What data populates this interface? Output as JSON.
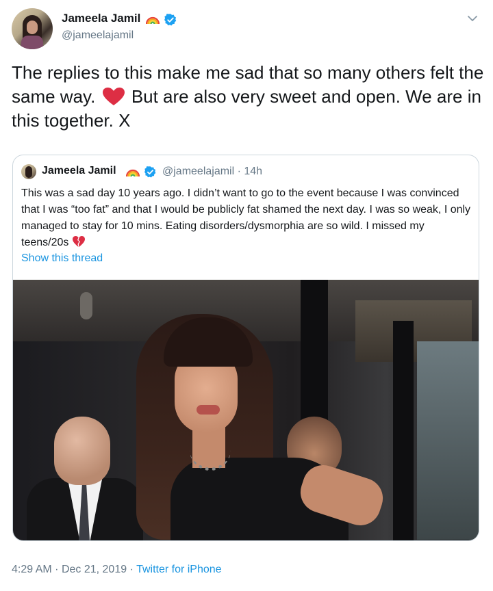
{
  "tweet": {
    "display_name": "Jameela Jamil",
    "handle": "@jameelajamil",
    "text_part1": "The replies to this make me sad that so many others felt the same way.",
    "text_part2": "But are also very sweet and open. We are in this together. X",
    "timestamp": "4:29 AM",
    "separator": "·",
    "date": "Dec 21, 2019",
    "source": "Twitter for iPhone"
  },
  "quote": {
    "display_name": "Jameela Jamil",
    "handle_time": "@jameelajamil · 14h",
    "text": "This was a sad day 10 years ago. I didn’t want to go to the event because I was convinced that I was “too fat” and that I would be publicly fat shamed the next day. I was so weak, I only managed to stay for 10 mins. Eating disorders/dysmorphia are so wild. I missed my teens/20s",
    "show_thread": "Show this thread"
  },
  "colors": {
    "link": "#1b95e0",
    "verified": "#1da1f2",
    "heart": "#dd2e44",
    "secondary_text": "#657786"
  }
}
